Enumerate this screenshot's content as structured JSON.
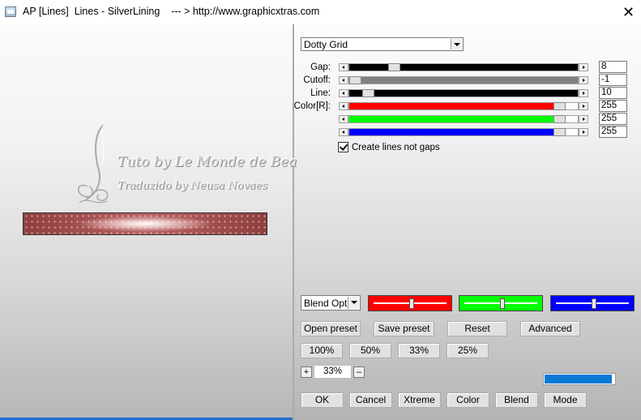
{
  "window": {
    "title": "AP [Lines]  Lines - SilverLining    --- > http://www.graphicxtras.com",
    "close_glyph": "✕"
  },
  "preview": {
    "watermark_line1": "Tuto by Le Monde de Bea",
    "watermark_line2": "Traduzido by Neusa Novaes",
    "bar_colors": [
      "#8f3e3e",
      "#b86262",
      "#ffffff"
    ]
  },
  "pattern_dropdown": {
    "value": "Dotty Grid"
  },
  "sliders": [
    {
      "label": "Gap:",
      "value": "8",
      "fraction": 0.18,
      "fill_color": "#000000"
    },
    {
      "label": "Cutoff:",
      "value": "-1",
      "fraction": 0.0,
      "fill_color": "#808080"
    },
    {
      "label": "Line:",
      "value": "10",
      "fraction": 0.06,
      "fill_color": "#000000"
    },
    {
      "label": "Color[R]:",
      "value": "255",
      "fraction": 0.945,
      "fill_color": "#ff0000"
    },
    {
      "label": "",
      "value": "255",
      "fraction": 0.945,
      "fill_color": "#00ff00"
    },
    {
      "label": "",
      "value": "255",
      "fraction": 0.945,
      "fill_color": "#0000ff"
    }
  ],
  "options": {
    "create_lines_label": "Create lines not gaps",
    "create_lines_checked": true
  },
  "blend_dropdown": {
    "value": "Blend Options"
  },
  "color_sliders": [
    {
      "color": "#ff0000",
      "fraction": 0.5
    },
    {
      "color": "#00ff00",
      "fraction": 0.5
    },
    {
      "color": "#0000ff",
      "fraction": 0.5
    }
  ],
  "preset_buttons": [
    "Open preset",
    "Save preset",
    "Reset",
    "Advanced"
  ],
  "zoom_buttons": [
    "100%",
    "50%",
    "33%",
    "25%"
  ],
  "zoom": {
    "plus": "+",
    "value": "33%",
    "minus": "–"
  },
  "progress": {
    "fraction": 0.97,
    "color": "#0a78d7"
  },
  "bottom_buttons": [
    "OK",
    "Cancel",
    "Xtreme",
    "Color",
    "Blend",
    "Mode"
  ]
}
